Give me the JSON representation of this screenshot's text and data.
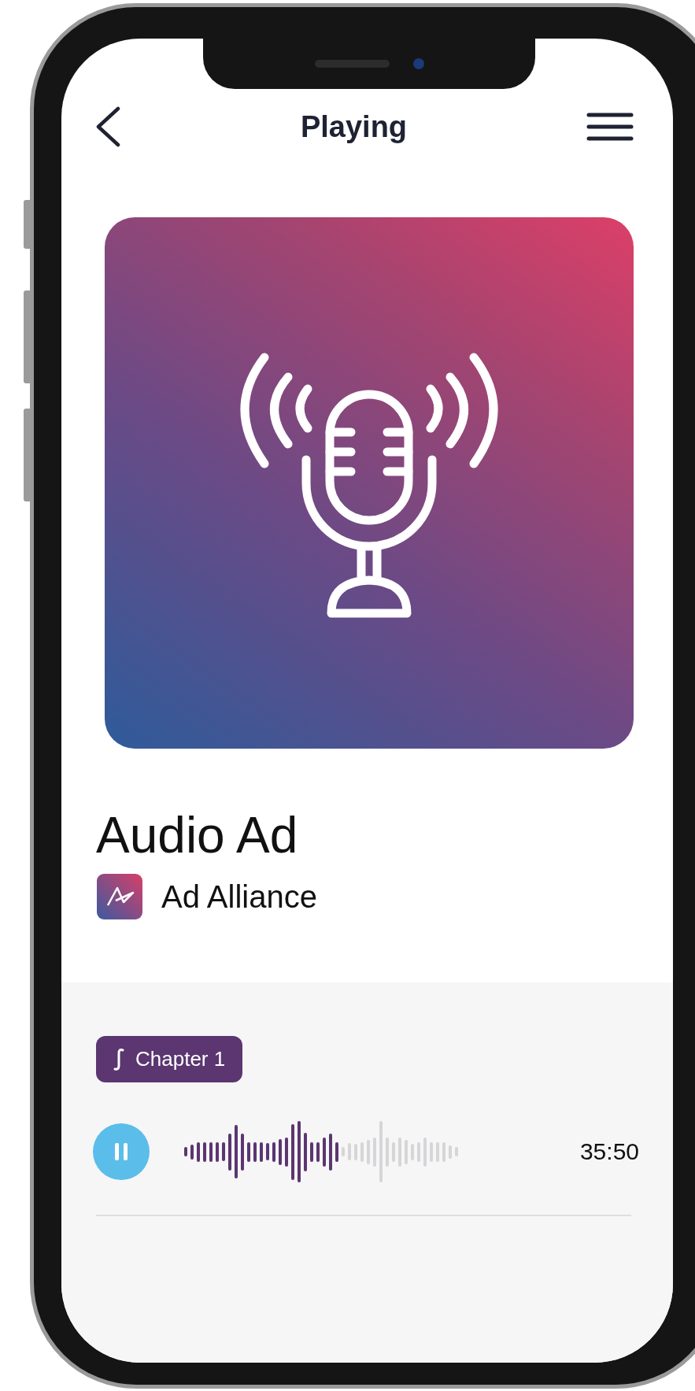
{
  "header": {
    "title": "Playing"
  },
  "episode": {
    "title": "Audio Ad",
    "publisher": "Ad Alliance"
  },
  "player": {
    "chapter": "Chapter 1",
    "playing": true,
    "level": 0.57,
    "time": "35:50"
  }
}
